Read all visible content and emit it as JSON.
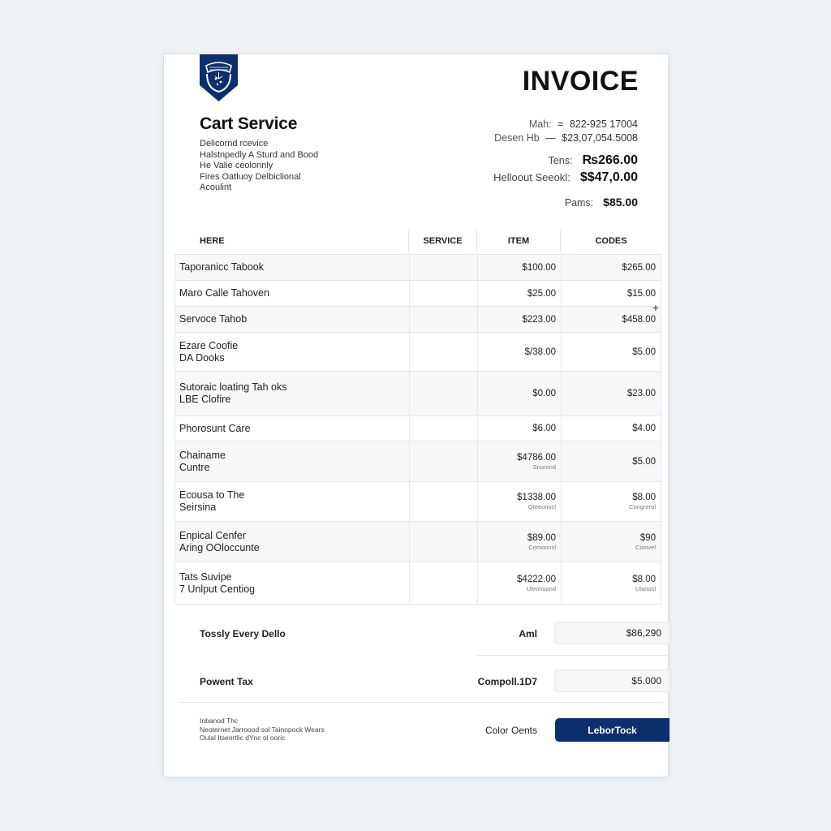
{
  "colors": {
    "brand": "#0d2f6e",
    "background": "#eef2f5",
    "row_alt": "#f6f8fa"
  },
  "company": {
    "logo_icon": "shield-crest-icon",
    "name": "Cart Service",
    "lines": [
      "Delicornd rcevice",
      "Halstnpedly A Sturd and Bood",
      "He Valie ceolonnly",
      "Fires Oatluoy Delbiclional",
      "Acoulint"
    ]
  },
  "invoice": {
    "title": "INVOICE",
    "meta": [
      {
        "label": "Mah:",
        "sep": "=",
        "value": "822-925 17004"
      },
      {
        "label": "Desen Hb",
        "sep": "—",
        "value": "$23,07,054.5008"
      }
    ],
    "top_totals": [
      {
        "label": "Tens:",
        "value": "₨266.00"
      },
      {
        "label": "Helloout Seeokl:",
        "value": "$$47,0.00"
      },
      {
        "label": "Pams:",
        "value": "$85.00"
      }
    ]
  },
  "table": {
    "headers": [
      "HERE",
      "SERVICE",
      "ITEM",
      "CODES"
    ],
    "rows": [
      {
        "desc": [
          "Taporanicc Tabook"
        ],
        "service": "",
        "item": "$100.00",
        "item_sub": "",
        "codes": "$265.00",
        "codes_sub": ""
      },
      {
        "desc": [
          "Maro Calle Tahoven"
        ],
        "service": "",
        "item": "$25.00",
        "item_sub": "",
        "codes": "$15.00",
        "codes_sub": ""
      },
      {
        "desc": [
          "Servoce Tahob"
        ],
        "service": "",
        "item": "$223.00",
        "item_sub": "",
        "codes": "$458.00",
        "codes_sub": ""
      },
      {
        "desc": [
          "Ezare Coofie",
          "DA Dooks"
        ],
        "service": "",
        "item": "$/38.00",
        "item_sub": "",
        "codes": "$5.00",
        "codes_sub": ""
      },
      {
        "desc": [
          "Sutoraic loating Tah oks",
          "LBE Clofire"
        ],
        "service": "",
        "item": "$0.00",
        "item_sub": "",
        "codes": "$23.00",
        "codes_sub": ""
      },
      {
        "desc": [
          "Phorosunt Care"
        ],
        "service": "",
        "item": "$6.00",
        "item_sub": "",
        "codes": "$4.00",
        "codes_sub": ""
      },
      {
        "desc": [
          "Chainame",
          "Cuntre"
        ],
        "service": "",
        "item": "$4786.00",
        "item_sub": "Snorond",
        "codes": "$5.00",
        "codes_sub": ""
      },
      {
        "desc": [
          "Ecousa to The",
          "Seirsina"
        ],
        "service": "",
        "item": "$1338.00",
        "item_sub": "Oteeonocl",
        "codes": "$8.00",
        "codes_sub": "Congrerol"
      },
      {
        "desc": [
          "Enpical Cenfer",
          "Aring OOloccunte"
        ],
        "service": "",
        "item": "$89.00",
        "item_sub": "Comoonsl",
        "codes": "$90",
        "codes_sub": "Cionvel"
      },
      {
        "desc": [
          "Tats Suvipe",
          "7 Unlput Centiog"
        ],
        "service": "",
        "item": "$4222.00",
        "item_sub": "Uleonoond",
        "codes": "$8.00",
        "codes_sub": "Ulanosl"
      }
    ],
    "add_icon": "plus-icon"
  },
  "summary": [
    {
      "label": "Tossly Every Dello",
      "mid": "Aml",
      "value": "$86,290"
    },
    {
      "label": "Powent Tax",
      "mid": "Compoll.1D7",
      "value": "$5.000"
    }
  ],
  "footer": {
    "notes": [
      "Inbanod Thc",
      "Neoternet Jarroood sol Tainopock  Wears",
      "Oulal Itseortlic dYnc ol ooric"
    ],
    "label": "Color Oents",
    "button_label": "LeborTock"
  }
}
